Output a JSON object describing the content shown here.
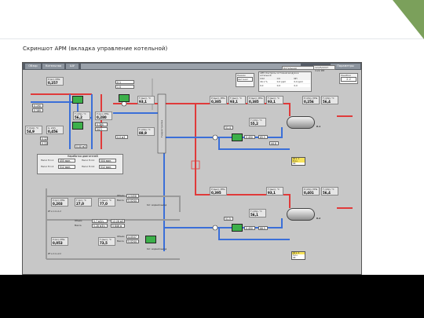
{
  "slide": {
    "title": "Скриншот АРМ (вкладка управление котельной)"
  },
  "toolbar": {
    "tabs": [
      "Обзор",
      "Котельная",
      "ШУ"
    ],
    "right_label": "Параметры"
  },
  "header": {
    "boiler_panel_title": "Котельная",
    "apm_panel_title": "АРМ. Контроль состояния воздуха в котельной",
    "datetime": "12/25/2017 3:22 PM",
    "mode_label": "Режим",
    "mode_value": "Автомат",
    "warn_label": "Ошибки",
    "warn_value": "1",
    "right_top_value": "2.2"
  },
  "apm_table": {
    "headers": [
      "СО2",
      "СО",
      "NH"
    ],
    "row1": [
      "40,1 %",
      "0,0 ppm",
      "0,0 ppm"
    ],
    "row2": [
      "0,0",
      "0,0",
      "0,0"
    ]
  },
  "left_block": {
    "p_in_label": "Р (вх), МПа",
    "p_in_value": "0,257",
    "t_labels": [
      "Т (прм), °С",
      "Т (обр), °С"
    ],
    "t_values": [
      "54,9",
      "56,2"
    ],
    "g_label": "G, м3/ч",
    "g_value": "0,456",
    "side_values": [
      "0,190",
      "0,189",
      "0,12",
      "0,13"
    ],
    "small": [
      "100%",
      "100%",
      "0,00 м3"
    ]
  },
  "center_block": {
    "labels": [
      "Т (вых), °С",
      "Т (обр), °С",
      "Р (вх), МПа"
    ],
    "values": [
      "93,1",
      "88,9",
      "0,280"
    ],
    "mid_values": [
      "0,385",
      "54,5"
    ],
    "small": [
      "0 1",
      "1 0",
      "0,0 м3"
    ]
  },
  "hours_panel": {
    "title": "Наработка двигателей",
    "rows": [
      {
        "label": "Насос Н-1.1",
        "value": "455 мин."
      },
      {
        "label": "Насос Н-1.2",
        "value": "512 мин."
      },
      {
        "label": "Насос Н-4.1",
        "value": "504 мин."
      },
      {
        "label": "Насос Н-4.2",
        "value": "512 мин."
      }
    ]
  },
  "upper_loop": {
    "tags": [
      {
        "t": "Р (вых), МПа",
        "v": "0,385"
      },
      {
        "t": "Т (вых), °С",
        "v": "93,1"
      },
      {
        "t": "Р (вых), МПа",
        "v": "0,385"
      },
      {
        "t": "Т (вых), °С",
        "v": "93,1"
      },
      {
        "t": "Т (обр), °С",
        "v": "55,2"
      },
      {
        "t": "Р (обр), МПа",
        "v": "0,256"
      },
      {
        "t": "Т (обр), °С",
        "v": "56,4"
      }
    ],
    "tank_label": "К-1",
    "small": [
      "51,4",
      "0,450",
      "65,5",
      "44,8"
    ],
    "legend": [
      "АО к. 1",
      "Н-1 к.",
      "ОК"
    ]
  },
  "lower_loop": {
    "tags": [
      {
        "t": "Р (вых), МПа",
        "v": "0,395"
      },
      {
        "t": "Т (вых), °С",
        "v": "93,1"
      },
      {
        "t": "Т (обр), °С",
        "v": "56,1"
      },
      {
        "t": "Р (обр), МПа",
        "v": "0,401"
      },
      {
        "t": "Т (обр), °С",
        "v": "56,4"
      }
    ],
    "tank_label": "К-2",
    "small": [
      "51,5",
      "0,450",
      "66,5"
    ],
    "legend": [
      "АО к. 2",
      "Н-2 к.",
      "ОК"
    ]
  },
  "bottom_block": {
    "rows": [
      {
        "t": "Р (вх), МПа",
        "v": "0,203"
      },
      {
        "t": "Т (вх), °С",
        "v": "27,0"
      },
      {
        "t": "Т (вых), °С",
        "v": "77,0"
      }
    ],
    "meter1": {
      "label1": "Объем",
      "v1": "4,0458",
      "label2": "Масса",
      "v2": "5,0244"
    },
    "meter2": {
      "label1": "Объем",
      "v1": "5,7 м3/ч",
      "v1b": "12,26 м3",
      "label2": "Масса",
      "v2": "5,28 м3/ч",
      "v2b": "5 846 м"
    },
    "meter3": {
      "label1": "Объем",
      "v1": "4,0537",
      "label2": "Масса",
      "v2": "5,0244"
    },
    "lower_tags": [
      {
        "t": "Р (вх), МПа",
        "v": "0,053"
      },
      {
        "t": "Т (вых), °С",
        "v": "73,5"
      },
      {
        "t": "Р (вх), МПа",
        "v": "0,353"
      }
    ],
    "notes": [
      "ИТ к.1.1 к.1.2",
      "ИТ к.2.1 к.2.2",
      "Кот. водяной выход",
      "Кот. водяной выход"
    ]
  }
}
